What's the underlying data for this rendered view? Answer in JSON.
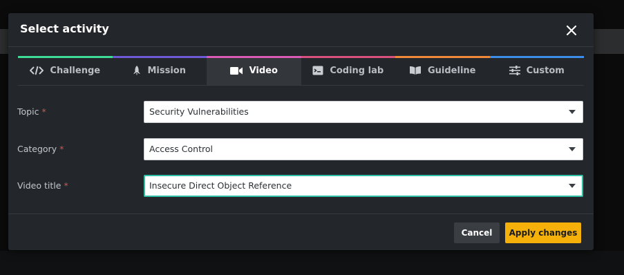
{
  "dialog": {
    "title": "Select activity"
  },
  "tabs": [
    {
      "label": "Challenge",
      "icon": "code-icon",
      "color": "#3ddc97",
      "active": false
    },
    {
      "label": "Mission",
      "icon": "rocket-icon",
      "color": "#6e5ad6",
      "active": false
    },
    {
      "label": "Video",
      "icon": "video-camera-icon",
      "color": "#d95bb6",
      "active": true
    },
    {
      "label": "Coding lab",
      "icon": "coding-lab-icon",
      "color": "#d94f7d",
      "active": false
    },
    {
      "label": "Guideline",
      "icon": "book-icon",
      "color": "#f08a3a",
      "active": false
    },
    {
      "label": "Custom",
      "icon": "sliders-icon",
      "color": "#3c8ee8",
      "active": false
    }
  ],
  "form": {
    "topic": {
      "label": "Topic",
      "required_mark": "*",
      "value": "Security Vulnerabilities"
    },
    "category": {
      "label": "Category",
      "required_mark": "*",
      "value": "Access Control"
    },
    "video_title": {
      "label": "Video title",
      "required_mark": "*",
      "value": "Insecure Direct Object Reference"
    }
  },
  "footer": {
    "cancel_label": "Cancel",
    "apply_label": "Apply changes"
  },
  "colors": {
    "accent_apply": "#f5b10a",
    "focus_border": "#2fbfa6",
    "required": "#d9534f"
  }
}
